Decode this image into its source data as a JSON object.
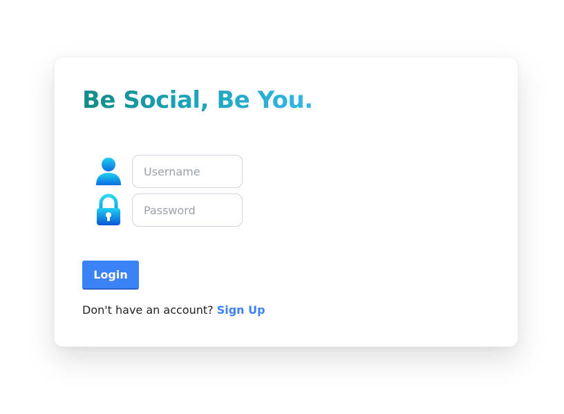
{
  "header": {
    "title": "Be Social, Be You."
  },
  "form": {
    "username": {
      "placeholder": "Username",
      "value": "",
      "icon": "user-icon"
    },
    "password": {
      "placeholder": "Password",
      "value": "",
      "icon": "lock-icon"
    },
    "login_label": "Login"
  },
  "footer": {
    "prompt": "Don't have an account?",
    "signup_label": "Sign Up"
  },
  "colors": {
    "accent": "#3b82f6",
    "title_gradient_start": "#138b86",
    "title_gradient_end": "#33b7e6",
    "icon_gradient_start": "#1fd0f0",
    "icon_gradient_end": "#0a6de0"
  }
}
